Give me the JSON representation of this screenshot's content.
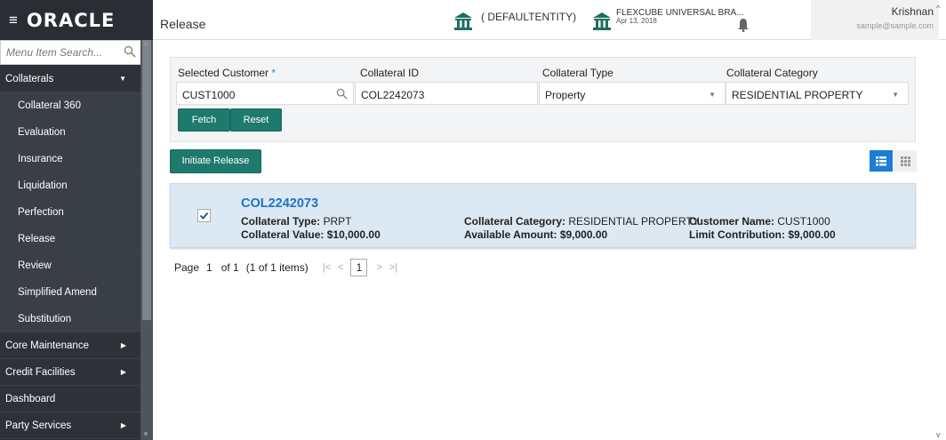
{
  "app": {
    "logo_text": "ORACLE",
    "page_title": "Release"
  },
  "header": {
    "entity": "( DEFAULTENTITY)",
    "branch": "FLEXCUBE UNIVERSAL BRA...",
    "branch_date": "Apr 13, 2018",
    "user_name": "Krishnan",
    "user_email": "sample@sample.com"
  },
  "sidebar": {
    "search_placeholder": "Menu Item Search...",
    "items": [
      {
        "label": "Collaterals",
        "level": "top",
        "arrow": "▼"
      },
      {
        "label": "Collateral 360",
        "level": "sub"
      },
      {
        "label": "Evaluation",
        "level": "sub"
      },
      {
        "label": "Insurance",
        "level": "sub"
      },
      {
        "label": "Liquidation",
        "level": "sub"
      },
      {
        "label": "Perfection",
        "level": "sub"
      },
      {
        "label": "Release",
        "level": "sub"
      },
      {
        "label": "Review",
        "level": "sub"
      },
      {
        "label": "Simplified Amend",
        "level": "sub"
      },
      {
        "label": "Substitution",
        "level": "sub"
      },
      {
        "label": "Core Maintenance",
        "level": "top",
        "arrow": "▶"
      },
      {
        "label": "Credit Facilities",
        "level": "top",
        "arrow": "▶"
      },
      {
        "label": "Dashboard",
        "level": "top"
      },
      {
        "label": "Party Services",
        "level": "top",
        "arrow": "▶"
      }
    ]
  },
  "filter": {
    "customer_label": "Selected Customer",
    "customer_required": "*",
    "customer_value": "CUST1000",
    "collateral_id_label": "Collateral ID",
    "collateral_id_value": "COL2242073",
    "collateral_type_label": "Collateral Type",
    "collateral_type_value": "Property",
    "collateral_category_label": "Collateral Category",
    "collateral_category_value": "RESIDENTIAL PROPERTY",
    "fetch_label": "Fetch",
    "reset_label": "Reset"
  },
  "actions": {
    "initiate_release_label": "Initiate Release"
  },
  "result": {
    "id": "COL2242073",
    "checked": true,
    "type_label": "Collateral Type:",
    "type_value": "PRPT",
    "value_label": "Collateral Value:",
    "value_value": "$10,000.00",
    "category_label": "Collateral Category:",
    "category_value": "RESIDENTIAL PROPERTY",
    "available_label": "Available Amount:",
    "available_value": "$9,000.00",
    "customer_label": "Customer Name:",
    "customer_value": "CUST1000",
    "limit_label": "Limit Contribution:",
    "limit_value": "$9,000.00"
  },
  "pagination": {
    "page_label": "Page",
    "page_number": "1",
    "of_text": "of 1",
    "items_text": "(1 of 1 items)",
    "current_page": "1"
  },
  "colors": {
    "accent_teal": "#1e7a6d",
    "link_blue": "#1b73c5",
    "sidebar_bg": "#2a2d33",
    "card_bg": "#dce9f3"
  }
}
